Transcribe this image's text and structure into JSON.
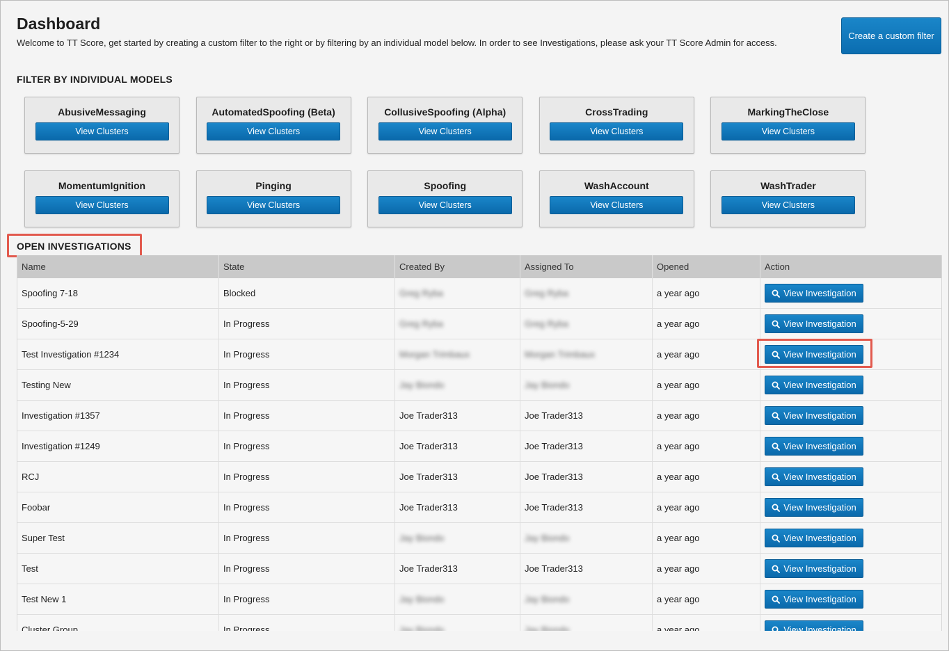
{
  "header": {
    "title": "Dashboard",
    "subtitle": "Welcome to TT Score, get started by creating a custom filter to the right or by filtering by an individual model below. In order to see Investigations, please ask your TT Score Admin for access.",
    "create_filter_label": "Create a custom filter"
  },
  "models": {
    "heading": "FILTER BY INDIVIDUAL MODELS",
    "button_label": "View Clusters",
    "items": [
      {
        "name": "AbusiveMessaging"
      },
      {
        "name": "AutomatedSpoofing (Beta)"
      },
      {
        "name": "CollusiveSpoofing (Alpha)"
      },
      {
        "name": "CrossTrading"
      },
      {
        "name": "MarkingTheClose"
      },
      {
        "name": "MomentumIgnition"
      },
      {
        "name": "Pinging"
      },
      {
        "name": "Spoofing"
      },
      {
        "name": "WashAccount"
      },
      {
        "name": "WashTrader"
      }
    ]
  },
  "investigations": {
    "heading": "OPEN INVESTIGATIONS",
    "columns": [
      "Name",
      "State",
      "Created By",
      "Assigned To",
      "Opened",
      "Action"
    ],
    "action_label": "View Investigation",
    "rows": [
      {
        "name": "Spoofing 7-18",
        "state": "Blocked",
        "created_by": "Greg Ryba",
        "assigned_to": "Greg Ryba",
        "opened": "a year ago",
        "blurred": true
      },
      {
        "name": "Spoofing-5-29",
        "state": "In Progress",
        "created_by": "Greg Ryba",
        "assigned_to": "Greg Ryba",
        "opened": "a year ago",
        "blurred": true
      },
      {
        "name": "Test Investigation #1234",
        "state": "In Progress",
        "created_by": "Morgan Trimbaux",
        "assigned_to": "Morgan Trimbaux",
        "opened": "a year ago",
        "blurred": true,
        "highlighted": true
      },
      {
        "name": "Testing New",
        "state": "In Progress",
        "created_by": "Jay Biondo",
        "assigned_to": "Jay Biondo",
        "opened": "a year ago",
        "blurred": true
      },
      {
        "name": "Investigation #1357",
        "state": "In Progress",
        "created_by": "Joe Trader313",
        "assigned_to": "Joe Trader313",
        "opened": "a year ago",
        "blurred": false
      },
      {
        "name": "Investigation #1249",
        "state": "In Progress",
        "created_by": "Joe Trader313",
        "assigned_to": "Joe Trader313",
        "opened": "a year ago",
        "blurred": false
      },
      {
        "name": "RCJ",
        "state": "In Progress",
        "created_by": "Joe Trader313",
        "assigned_to": "Joe Trader313",
        "opened": "a year ago",
        "blurred": false
      },
      {
        "name": "Foobar",
        "state": "In Progress",
        "created_by": "Joe Trader313",
        "assigned_to": "Joe Trader313",
        "opened": "a year ago",
        "blurred": false
      },
      {
        "name": "Super Test",
        "state": "In Progress",
        "created_by": "Jay Biondo",
        "assigned_to": "Jay Biondo",
        "opened": "a year ago",
        "blurred": true
      },
      {
        "name": "Test",
        "state": "In Progress",
        "created_by": "Joe Trader313",
        "assigned_to": "Joe Trader313",
        "opened": "a year ago",
        "blurred": false
      },
      {
        "name": "Test New 1",
        "state": "In Progress",
        "created_by": "Jay Biondo",
        "assigned_to": "Jay Biondo",
        "opened": "a year ago",
        "blurred": true
      },
      {
        "name": "Cluster Group",
        "state": "In Progress",
        "created_by": "Jay Biondo",
        "assigned_to": "Jay Biondo",
        "opened": "a year ago",
        "blurred": true
      }
    ]
  },
  "colors": {
    "accent_blue": "#0b6db0",
    "highlight_red": "#e25a4e",
    "header_gray": "#c9c9c9"
  }
}
